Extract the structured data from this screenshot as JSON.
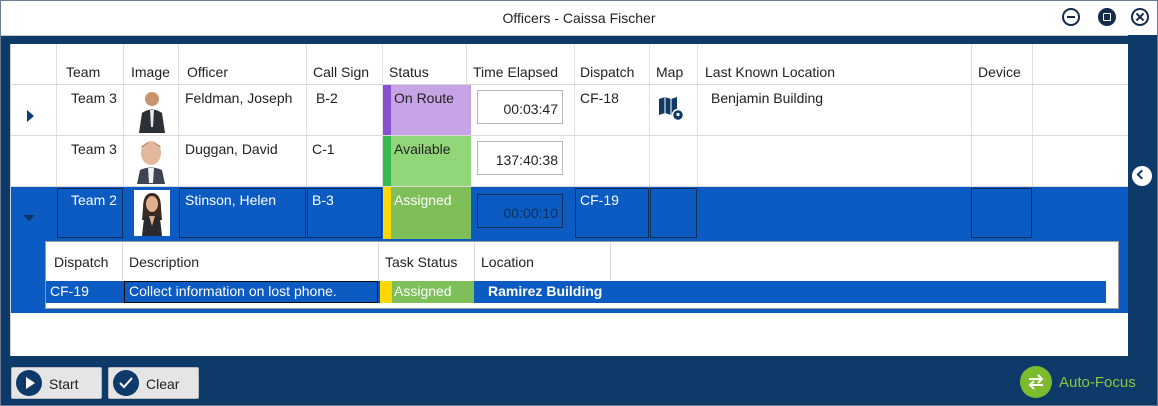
{
  "window": {
    "title": "Officers - Caissa Fischer"
  },
  "columns": {
    "team": "Team",
    "image": "Image",
    "officer": "Officer",
    "call_sign": "Call Sign",
    "status": "Status",
    "time_elapsed": "Time Elapsed",
    "dispatch": "Dispatch",
    "map": "Map",
    "last_known_location": "Last Known Location",
    "device": "Device"
  },
  "rows": [
    {
      "team": "Team 3",
      "officer": "Feldman, Joseph",
      "call_sign": "B-2",
      "status": "On Route",
      "status_color": "#c7a4e6",
      "status_bar": "#8a4fd1",
      "time": "00:03:47",
      "dispatch": "CF-18",
      "map_icon": "map-pin-icon",
      "location": "Benjamin Building",
      "device": ""
    },
    {
      "team": "Team 3",
      "officer": "Duggan, David",
      "call_sign": "C-1",
      "status": "Available",
      "status_color": "#92d67a",
      "status_bar": "#34b94a",
      "time": "137:40:38",
      "dispatch": "",
      "location": "",
      "device": ""
    },
    {
      "team": "Team 2",
      "officer": "Stinson, Helen",
      "call_sign": "B-3",
      "status": "Assigned",
      "status_color": "#7fbf5a",
      "status_bar": "#ffd800",
      "time": "00:00:10",
      "dispatch": "CF-19",
      "location": "",
      "device": ""
    }
  ],
  "detail": {
    "columns": {
      "dispatch": "Dispatch",
      "description": "Description",
      "task_status": "Task Status",
      "location": "Location"
    },
    "row": {
      "dispatch": "CF-19",
      "description": "Collect information on lost phone.",
      "task_status": "Assigned",
      "task_status_color": "#7fbf5a",
      "task_status_bar": "#ffd800",
      "location": "Ramirez Building"
    }
  },
  "toolbar": {
    "start_label": "Start",
    "clear_label": "Clear",
    "autofocus_label": "Auto-Focus"
  },
  "colors": {
    "accent": "#0b5bc2",
    "frame": "#0e3a6a",
    "autofocus": "#7dbb2e"
  }
}
